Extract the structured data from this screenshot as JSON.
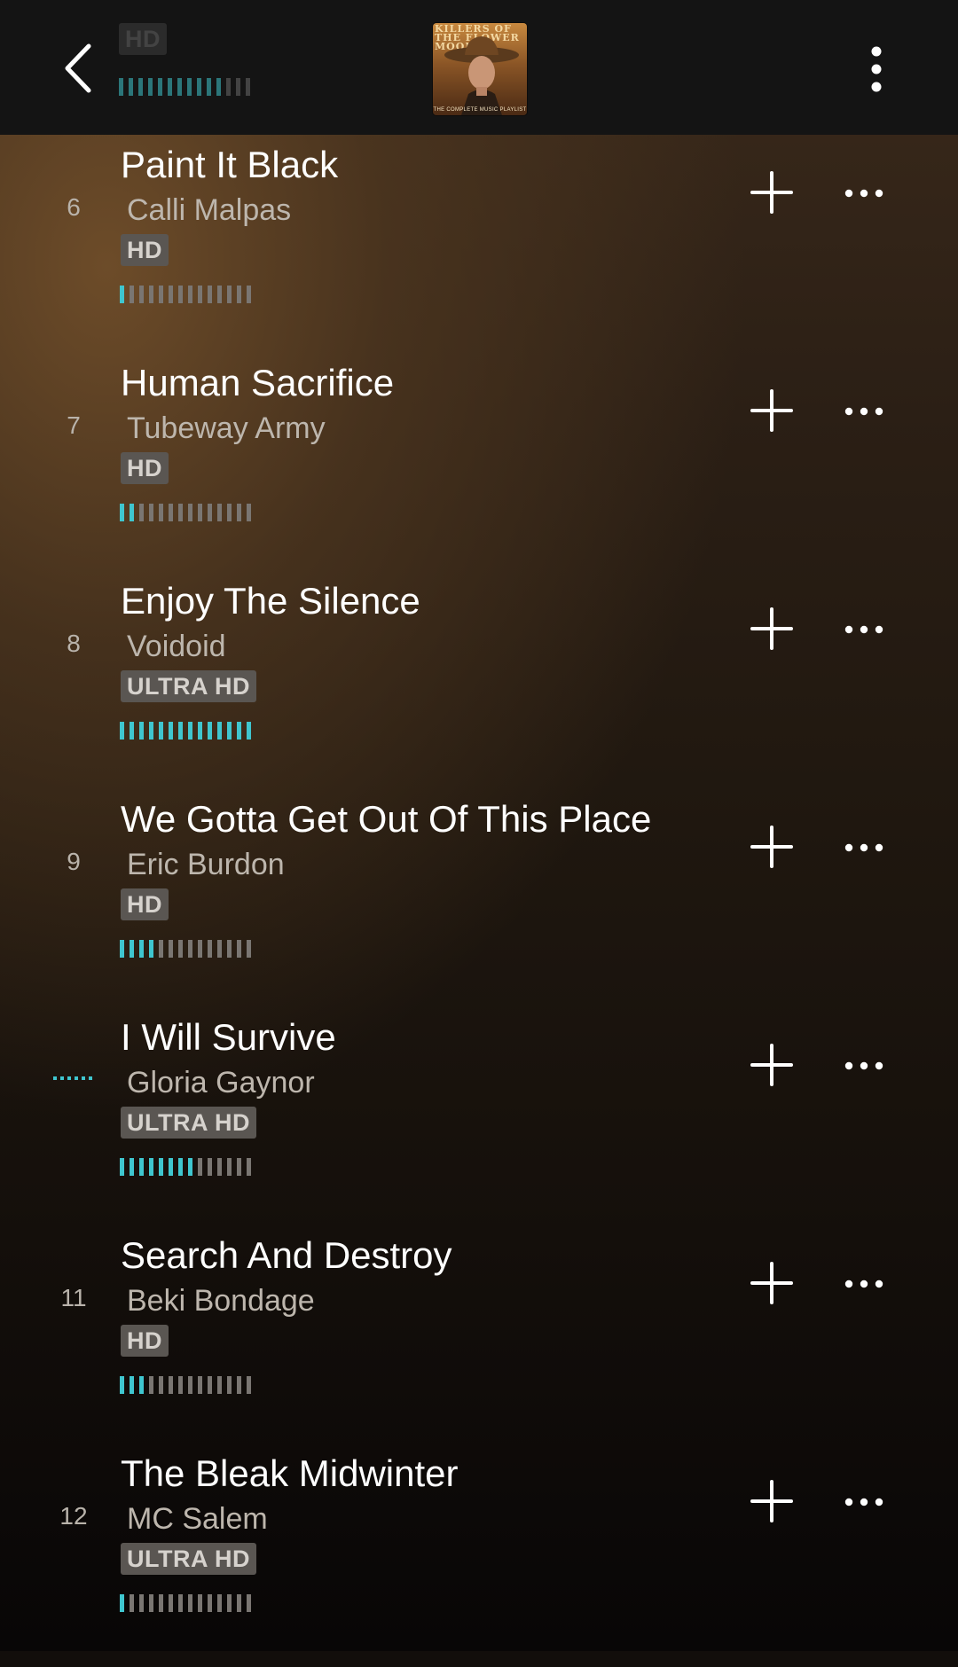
{
  "header": {
    "album_cover_title": "KILLERS OF THE FLOWER MOON",
    "album_cover_subtitle": "THE COMPLETE MUSIC PLAYLIST",
    "peek_badge": "HD"
  },
  "tracks": [
    {
      "number": "6",
      "title": "Paint It Black",
      "artist": "Calli Malpas",
      "quality": "HD",
      "level": 1,
      "now_playing": false
    },
    {
      "number": "7",
      "title": "Human Sacrifice",
      "artist": "Tubeway Army",
      "quality": "HD",
      "level": 2,
      "now_playing": false
    },
    {
      "number": "8",
      "title": "Enjoy The Silence",
      "artist": "Voidoid",
      "quality": "ULTRA HD",
      "level": 14,
      "now_playing": false
    },
    {
      "number": "9",
      "title": "We Gotta Get Out Of This Place",
      "artist": "Eric Burdon",
      "quality": "HD",
      "level": 4,
      "now_playing": false
    },
    {
      "number": "",
      "title": "I Will Survive",
      "artist": "Gloria Gaynor",
      "quality": "ULTRA HD",
      "level": 8,
      "now_playing": true
    },
    {
      "number": "11",
      "title": "Search And Destroy",
      "artist": "Beki Bondage",
      "quality": "HD",
      "level": 3,
      "now_playing": false
    },
    {
      "number": "12",
      "title": "The Bleak Midwinter",
      "artist": "MC Salem",
      "quality": "ULTRA HD",
      "level": 1,
      "now_playing": false
    }
  ],
  "meter_segments": 14,
  "colors": {
    "accent": "#3fc6cf",
    "meter_off": "#7a7672",
    "badge_bg": "#5a5652",
    "header_bg": "#141414"
  },
  "icons": {
    "back": "chevron-left-icon",
    "menu": "kebab-vertical-icon",
    "add": "plus-icon",
    "more": "ellipsis-horizontal-icon",
    "playing": "now-playing-dots-icon"
  }
}
